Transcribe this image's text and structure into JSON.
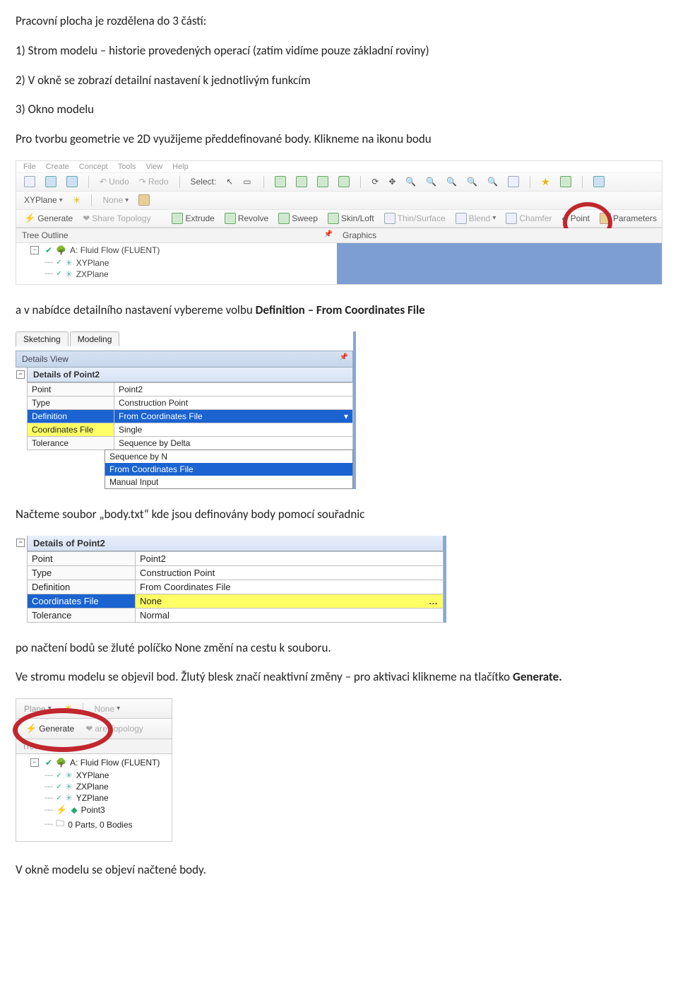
{
  "paras": {
    "p1": "Pracovní plocha je rozdělena do 3 částí:",
    "p2": "1) Strom modelu – historie provedených operací (zatím vidíme pouze základní roviny)",
    "p3": "2) V okně se zobrazí detailní nastavení k jednotlivým funkcím",
    "p4": "3) Okno modelu",
    "p5": "Pro tvorbu geometrie ve 2D využijeme předdefinované body. Klikneme na ikonu bodu",
    "p6a": "a v nabídce detailního nastavení vybereme volbu ",
    "p6b": "Definition – From Coordinates File",
    "p7": "Načteme soubor „body.txt“ kde jsou definovány body pomocí souřadnic",
    "p8": "po načtení bodů se žluté políčko None změní na cestu k souboru.",
    "p9a": "Ve stromu modelu se objevil bod. Žlutý blesk značí neaktivní změny – pro aktivaci klikneme na tlačítko ",
    "p9b": "Generate.",
    "p10": "V okně modelu se objeví načtené body."
  },
  "s1": {
    "menu": [
      "File",
      "Create",
      "Concept",
      "Tools",
      "View",
      "Help"
    ],
    "undo": "Undo",
    "redo": "Redo",
    "select": "Select:",
    "xyplane": "XYPlane",
    "none": "None",
    "generate": "Generate",
    "sharetopo": "Share Topology",
    "tools": [
      "Extrude",
      "Revolve",
      "Sweep",
      "Skin/Loft",
      "Thin/Surface",
      "Blend",
      "Chamfer",
      "Point",
      "Parameters"
    ],
    "treeOutline": "Tree Outline",
    "graphics": "Graphics",
    "treeRoot": "A: Fluid Flow (FLUENT)",
    "planes": [
      "XYPlane",
      "ZXPlane"
    ]
  },
  "s2": {
    "tabs": [
      "Sketching",
      "Modeling"
    ],
    "dvTitle": "Details View",
    "subTitle": "Details of Point2",
    "rows": [
      {
        "k": "Point",
        "v": "Point2"
      },
      {
        "k": "Type",
        "v": "Construction Point"
      },
      {
        "k": "Definition",
        "v": "From Coordinates File"
      },
      {
        "k": "Coordinates File",
        "v": "Single"
      },
      {
        "k": "Tolerance",
        "v": "Sequence by Delta"
      }
    ],
    "ddOptions": [
      "Sequence by N",
      "From Coordinates File",
      "Manual Input"
    ],
    "ddSelected": "From Coordinates File"
  },
  "s3": {
    "subTitle": "Details of Point2",
    "rows": [
      {
        "k": "Point",
        "v": "Point2"
      },
      {
        "k": "Type",
        "v": "Construction Point"
      },
      {
        "k": "Definition",
        "v": "From Coordinates File"
      },
      {
        "k": "Coordinates File",
        "v": "None"
      },
      {
        "k": "Tolerance",
        "v": "Normal"
      }
    ]
  },
  "s4": {
    "plane": "Plane",
    "none": "None",
    "generate": "Generate",
    "topo": "are Topology",
    "treeLabel": "Tree",
    "treeRoot": "A: Fluid Flow (FLUENT)",
    "items": [
      "XYPlane",
      "ZXPlane",
      "YZPlane",
      "Point3",
      "0 Parts, 0 Bodies"
    ]
  }
}
